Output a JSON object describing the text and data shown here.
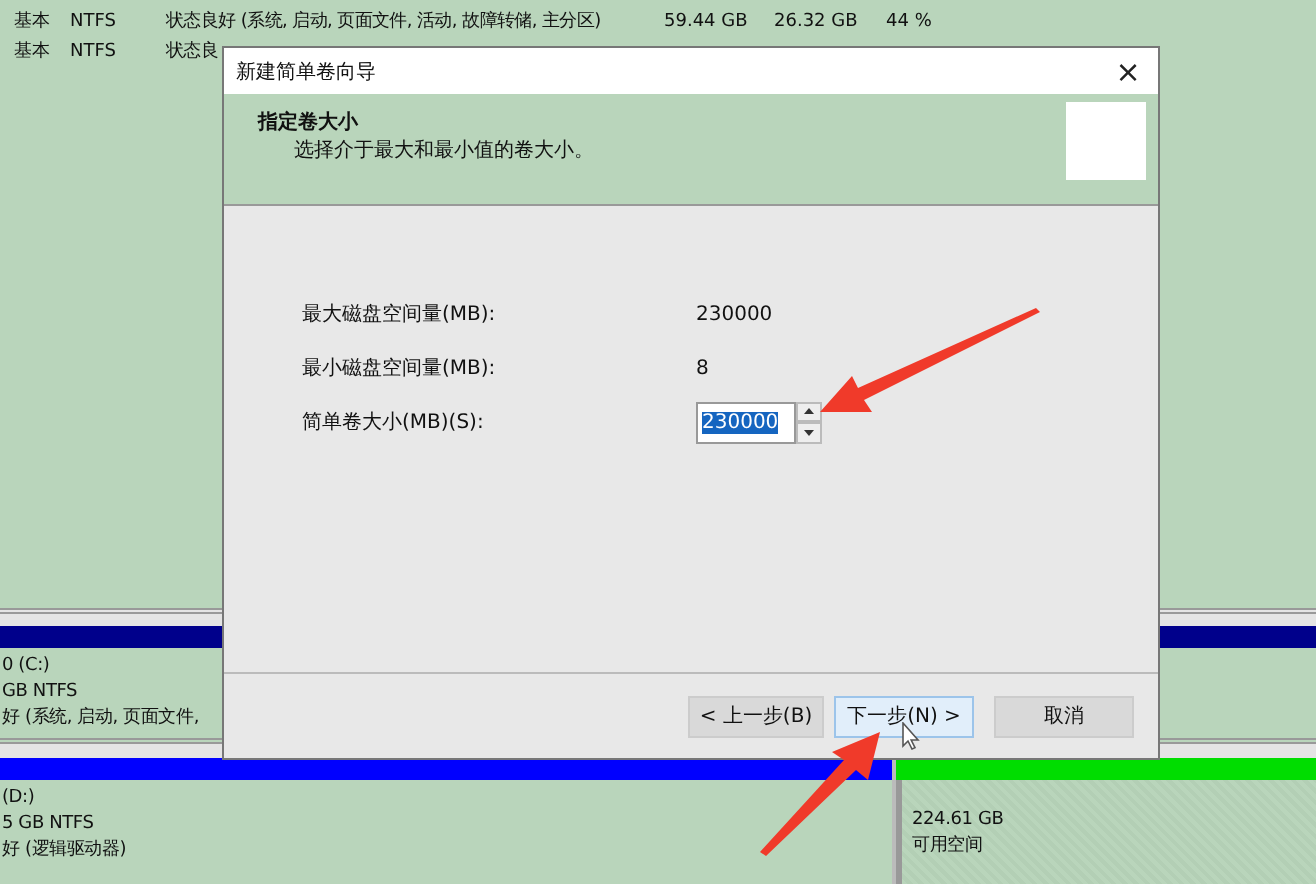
{
  "volume_list": [
    {
      "layout": "基本",
      "fs": "NTFS",
      "status": "状态良好 (系统, 启动, 页面文件, 活动, 故障转储, 主分区)",
      "capacity": "59.44 GB",
      "free": "26.32 GB",
      "percent": "44 %"
    },
    {
      "layout": "基本",
      "fs": "NTFS",
      "status": "状态良"
    }
  ],
  "disk_map": {
    "partitions": [
      {
        "kind": "primary",
        "selected": false,
        "lines": [
          "0  (C:)",
          "GB NTFS",
          "好 (系统, 启动, 页面文件,"
        ]
      },
      {
        "kind": "logical",
        "selected": false,
        "lines": [
          "(D:)",
          "5 GB NTFS",
          "好 (逻辑驱动器)"
        ]
      },
      {
        "kind": "unallocated",
        "selected": false,
        "lines": [
          "224.61 GB",
          "可用空间"
        ]
      }
    ]
  },
  "dialog": {
    "title": "新建简单卷向导",
    "close": "×",
    "header": {
      "title": "指定卷大小",
      "subtitle": "选择介于最大和最小值的卷大小。"
    },
    "fields": [
      {
        "kind": "readonly",
        "label": "最大磁盘空间量(MB):",
        "value": "230000"
      },
      {
        "kind": "readonly",
        "label": "最小磁盘空间量(MB):",
        "value": "8"
      },
      {
        "kind": "spinner",
        "label": "简单卷大小(MB)(S):",
        "value": "230000",
        "text_selected": true
      }
    ],
    "buttons": [
      {
        "label": "< 上一步(B)",
        "hovered": false
      },
      {
        "label": "下一步(N) >",
        "hovered": true
      },
      {
        "label": "取消",
        "hovered": false
      }
    ]
  }
}
